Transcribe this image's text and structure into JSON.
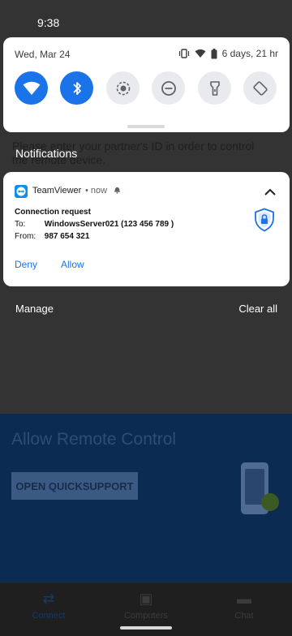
{
  "status_bar": {
    "time": "9:38"
  },
  "quick_settings": {
    "date": "Wed, Mar 24",
    "battery": "6 days, 21 hr",
    "tiles": [
      {
        "name": "wifi",
        "on": true
      },
      {
        "name": "bluetooth",
        "on": true
      },
      {
        "name": "screen-record",
        "on": false
      },
      {
        "name": "do-not-disturb",
        "on": false
      },
      {
        "name": "flashlight",
        "on": false
      },
      {
        "name": "auto-rotate",
        "on": false
      }
    ]
  },
  "notifications": {
    "header": "Notifications",
    "card": {
      "app_name": "TeamViewer",
      "time": "• now",
      "title": "Connection request",
      "to_label": "To:",
      "to_value": "WindowsServer021 (123 456 789 )",
      "from_label": "From:",
      "from_value": "987 654 321",
      "actions": {
        "deny": "Deny",
        "allow": "Allow"
      }
    },
    "manage": "Manage",
    "clear_all": "Clear all"
  },
  "background_app": {
    "instruction": "Please enter your partner's ID in order to control the remote device.",
    "heading": "Allow Remote Control",
    "button": "OPEN QUICKSUPPORT",
    "nav": [
      {
        "label": "Connect",
        "icon": "arrows-icon"
      },
      {
        "label": "Computers",
        "icon": "contacts-icon"
      },
      {
        "label": "Chat",
        "icon": "chat-icon"
      }
    ]
  },
  "colors": {
    "accent": "#1a73e8",
    "tile_off": "#e8eaed",
    "teamviewer": "#0e8ee9"
  }
}
